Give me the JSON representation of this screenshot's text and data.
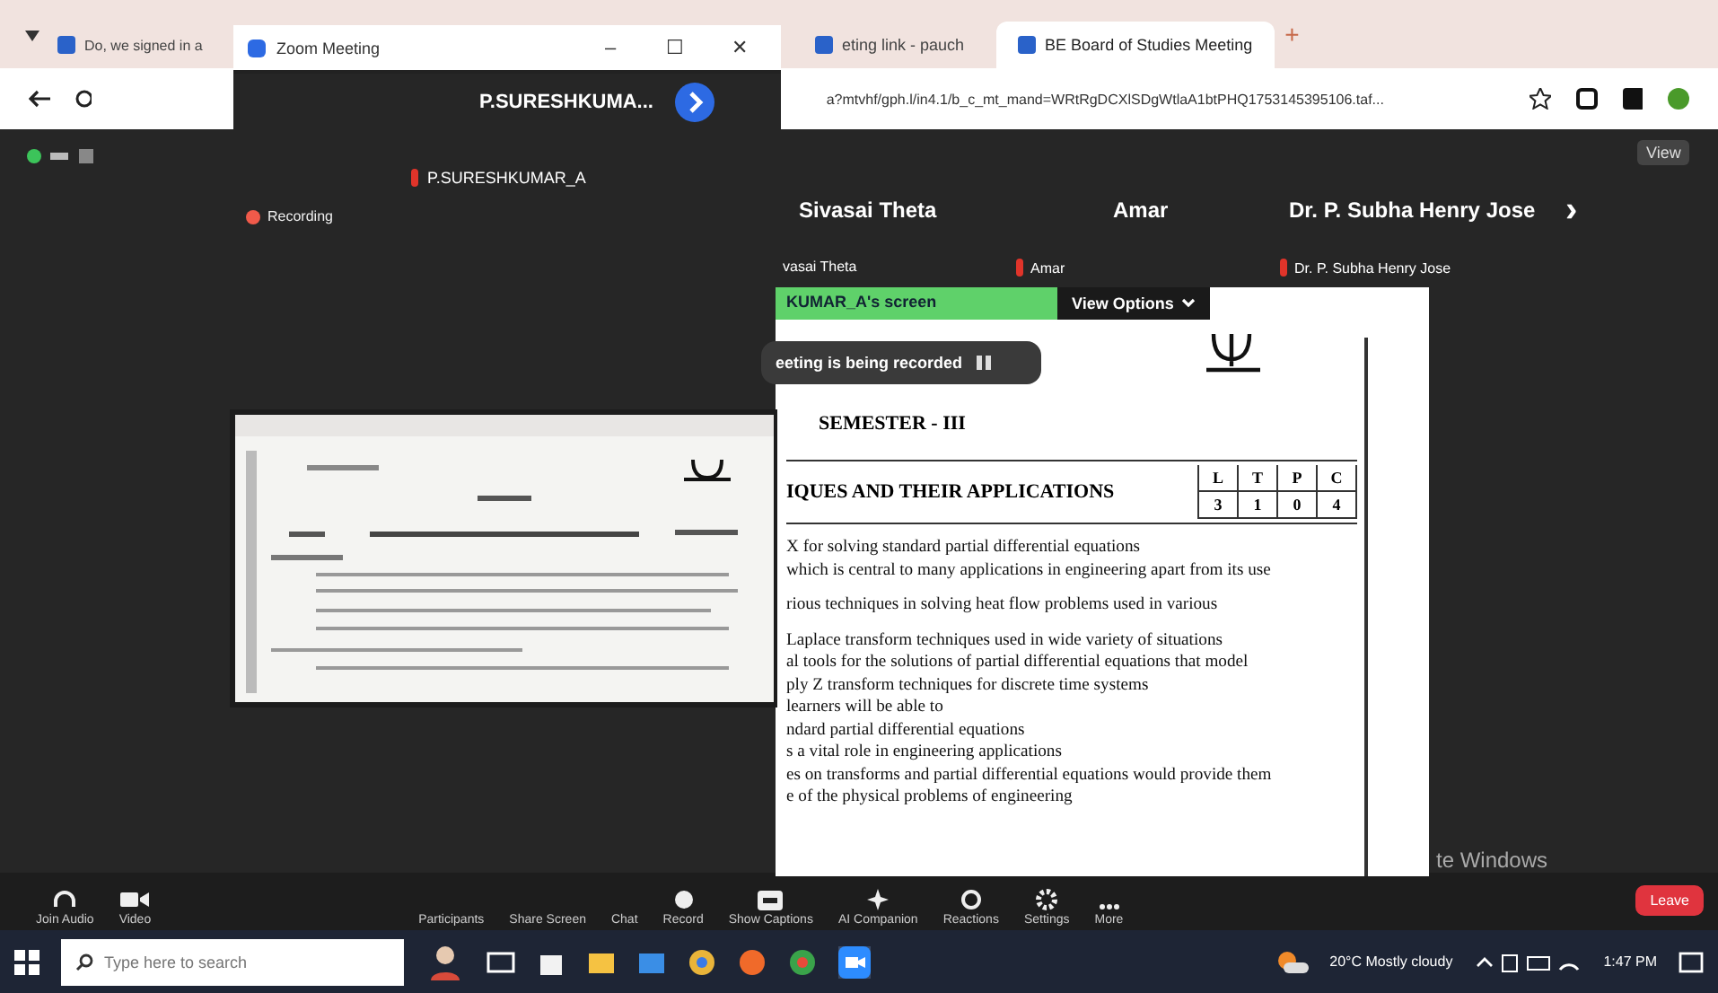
{
  "browser": {
    "tabs": [
      {
        "title": "Do, we signed in a",
        "selected": false
      },
      {
        "title": "eting link - pauch",
        "selected": false
      },
      {
        "title": "BE Board of Studies Meeting",
        "selected": true
      }
    ],
    "new_tab": "+",
    "url": "a?mtvhf/gph.l/in4.1/b_c_mt_mand=WRtRgDCXlSDgWtlaA1btPHQ1753145395106.taf..."
  },
  "zoom_window": {
    "title": "Zoom Meeting",
    "controls": [
      "–",
      "☐",
      "✕"
    ],
    "speaker": "P.SURESHKUMA..."
  },
  "meeting": {
    "view_label": "View",
    "self_label": "P.SURESHKUMAR_A",
    "recording_label": "Recording",
    "participants": [
      {
        "name": "Sivasai Theta",
        "caption": "vasai Theta",
        "muted": false
      },
      {
        "name": "Amar",
        "caption": "Amar",
        "muted": true
      },
      {
        "name": "Dr. P. Subha Henry Jose",
        "caption": "Dr. P. Subha Henry Jose",
        "muted": true
      }
    ],
    "next": "›"
  },
  "share": {
    "owner": "KUMAR_A's screen",
    "view_options": "View Options",
    "recording_banner": "eeting is being recorded",
    "doc": {
      "semester": "SEMESTER - III",
      "course": "IQUES AND THEIR APPLICATIONS",
      "ltpc_headers": [
        "L",
        "T",
        "P",
        "C"
      ],
      "ltpc_values": [
        "3",
        "1",
        "0",
        "4"
      ],
      "lines": [
        "X  for solving standard partial differential equations",
        "which is central to many applications in engineering apart from its use",
        "rious techniques in solving heat flow problems used in various",
        "Laplace transform techniques used in wide variety of situations",
        "al tools for the solutions of partial differential equations that model",
        "ply Z transform techniques for discrete time systems",
        "learners will be able to",
        "ndard partial differential equations",
        "s a vital role in engineering applications",
        "es on transforms and partial differential equations would provide them",
        "e of the physical problems of engineering"
      ]
    }
  },
  "os_notice": "te Windows",
  "toolbar": [
    {
      "label": "Join Audio",
      "kind": "headphones"
    },
    {
      "label": "Video",
      "kind": "video"
    },
    {
      "label": "Participants",
      "kind": "plain"
    },
    {
      "label": "Share Screen",
      "kind": "plain"
    },
    {
      "label": "Chat",
      "kind": "plain"
    },
    {
      "label": "Record",
      "kind": "record"
    },
    {
      "label": "Show Captions",
      "kind": "captions"
    },
    {
      "label": "AI Companion",
      "kind": "sparkle"
    },
    {
      "label": "Reactions",
      "kind": "reactions"
    },
    {
      "label": "Settings",
      "kind": "gear"
    },
    {
      "label": "More",
      "kind": "more"
    }
  ],
  "leave": "Leave",
  "taskbar": {
    "search_placeholder": "Type here to search",
    "weather": "20°C  Mostly cloudy",
    "time": "1:47 PM"
  }
}
